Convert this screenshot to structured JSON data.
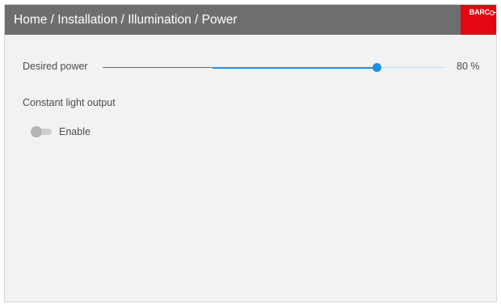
{
  "header": {
    "breadcrumb": "Home / Installation / Illumination / Power",
    "brand_text": "BARC",
    "brand_color": "#e30613",
    "header_color": "#6e6e6e"
  },
  "power": {
    "label": "Desired power",
    "value_text": "80 %",
    "slider_fraction": 0.8,
    "accent_color": "#1f8fdc"
  },
  "constant_light_output": {
    "heading": "Constant light output",
    "toggle_label": "Enable",
    "enabled": false
  }
}
